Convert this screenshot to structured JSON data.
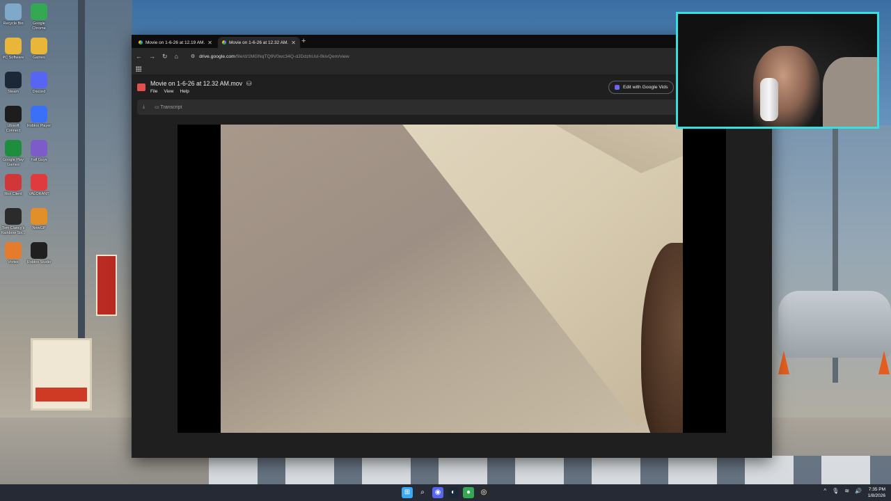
{
  "desktop": {
    "icons": [
      {
        "label": "Recycle Bin",
        "icon": "recycle-bin-icon",
        "color": "#7fa9c9"
      },
      {
        "label": "Google Chrome",
        "icon": "chrome-icon",
        "color": "#34a853"
      },
      {
        "label": "PC Software",
        "icon": "folder-icon",
        "color": "#e8b73a"
      },
      {
        "label": "Games",
        "icon": "folder-icon",
        "color": "#e8b73a"
      },
      {
        "label": "Steam",
        "icon": "steam-icon",
        "color": "#1b2838"
      },
      {
        "label": "Discord",
        "icon": "discord-icon",
        "color": "#5865f2"
      },
      {
        "label": "Ubisoft Connect",
        "icon": "ubisoft-icon",
        "color": "#1d1d1d"
      },
      {
        "label": "Roblox Player",
        "icon": "roblox-icon",
        "color": "#3a6ff7"
      },
      {
        "label": "Google Play Games",
        "icon": "google-play-games-icon",
        "color": "#1e8e3e"
      },
      {
        "label": "Fall Guys",
        "icon": "fall-guys-icon",
        "color": "#7b5cc8"
      },
      {
        "label": "Riot Client",
        "icon": "riot-client-icon",
        "color": "#d13639"
      },
      {
        "label": "VALORANT",
        "icon": "valorant-icon",
        "color": "#e0393e"
      },
      {
        "label": "Tom Clancy's Rainbow Six...",
        "icon": "rainbow-six-icon",
        "color": "#2b2b2b"
      },
      {
        "label": "NewGP",
        "icon": "newgp-icon",
        "color": "#e28f2a"
      },
      {
        "label": "Vortex",
        "icon": "vortex-icon",
        "color": "#e57b2c"
      },
      {
        "label": "Roblox Studio",
        "icon": "roblox-studio-icon",
        "color": "#1f1f1f"
      }
    ]
  },
  "browser": {
    "tabs": [
      {
        "title": "Movie on 1-6-26 at 12.19 AM.m",
        "close": "✕"
      },
      {
        "title": "Movie on 1-6-26 at 12.32 AM.m",
        "close": "✕"
      }
    ],
    "new_tab": "+",
    "nav": {
      "back": "←",
      "forward": "→",
      "reload": "↻",
      "home": "⌂"
    },
    "address": {
      "host": "drive.google.com",
      "path": "/file/d/1MGNqTQ9V0wc34Q-dJDdzhUsl-0kivQem/view"
    }
  },
  "drive": {
    "file_title": "Movie on 1-6-26 at 12.32 AM.mov",
    "menu": [
      "File",
      "View",
      "Help"
    ],
    "edit_button": "Edit with Google Vids",
    "transcript": "Transcript",
    "download_icon": "download-icon"
  },
  "taskbar": {
    "pinned": [
      {
        "icon": "windows-start-icon",
        "glyph": "⊞",
        "color": "#3ba8f5"
      },
      {
        "icon": "search-icon",
        "glyph": "⌕",
        "color": "transparent"
      },
      {
        "icon": "discord-icon",
        "glyph": "◉",
        "color": "#5865f2"
      },
      {
        "icon": "steam-icon",
        "glyph": "◐",
        "color": "#1b2838"
      },
      {
        "icon": "chrome-icon",
        "glyph": "●",
        "color": "#34a853"
      },
      {
        "icon": "obs-icon",
        "glyph": "◎",
        "color": "#2a2a2a"
      }
    ],
    "time": "7:35 PM",
    "date": "1/8/2026"
  },
  "colors": {
    "webcam_border": "#36e0e0",
    "accent": "#8ab4f8"
  }
}
